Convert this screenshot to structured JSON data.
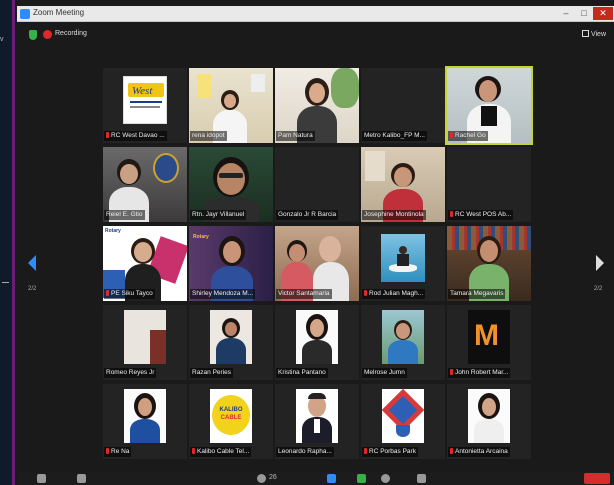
{
  "window": {
    "title": "Zoom Meeting"
  },
  "left_strip": {
    "label": "v"
  },
  "toolbar": {
    "recording_label": "Recording",
    "view_label": "View"
  },
  "pager": {
    "left_indicator": "2/2",
    "right_indicator": "2/2"
  },
  "participants": [
    {
      "name": "RC West Davao ...",
      "muted": true
    },
    {
      "name": "rena idopot",
      "muted": false
    },
    {
      "name": "Pam Natura",
      "muted": false
    },
    {
      "name": "Metro Kalibo_FP M...",
      "muted": false
    },
    {
      "name": "Rachel Go",
      "muted": true
    },
    {
      "name": "Reiel E. Gtio",
      "muted": false
    },
    {
      "name": "Rtn. Jayr Villanuel",
      "muted": false
    },
    {
      "name": "Gonzalo Jr R Barcia",
      "muted": false
    },
    {
      "name": "Josephine Montinola",
      "muted": false
    },
    {
      "name": "RC West POS Ab...",
      "muted": true
    },
    {
      "name": "PE Siku Tayco",
      "muted": true
    },
    {
      "name": "Shirley Mendoza M...",
      "muted": false
    },
    {
      "name": "Victor Santamaria",
      "muted": false
    },
    {
      "name": "Rod Julian Magh...",
      "muted": true
    },
    {
      "name": "Tamara Megavaris",
      "muted": false
    },
    {
      "name": "Romeo Reyes Jr",
      "muted": false
    },
    {
      "name": "Razan Peries",
      "muted": false
    },
    {
      "name": "Kristina Pantano",
      "muted": false
    },
    {
      "name": "Melrose Jumn",
      "muted": false
    },
    {
      "name": "John Robert Mar...",
      "muted": true
    },
    {
      "name": "Re Na",
      "muted": true
    },
    {
      "name": "Kalibo Cable Tel...",
      "muted": true
    },
    {
      "name": "Leonardo Rapha...",
      "muted": false
    },
    {
      "name": "RC Porbas Park",
      "muted": true
    },
    {
      "name": "Antonietta Arcaina",
      "muted": true
    }
  ],
  "tile_logos": {
    "west_logo_text": "West",
    "rotary_text": "Rotary",
    "kalibo_text": "KALIBO",
    "cable_text": "CABLE"
  },
  "bottom_toolbar": {
    "participants_count": "26"
  },
  "colors": {
    "accent": "#2d8cff",
    "active_speaker": "#c4d531",
    "recording": "#e02828",
    "end": "#d62c2c"
  }
}
